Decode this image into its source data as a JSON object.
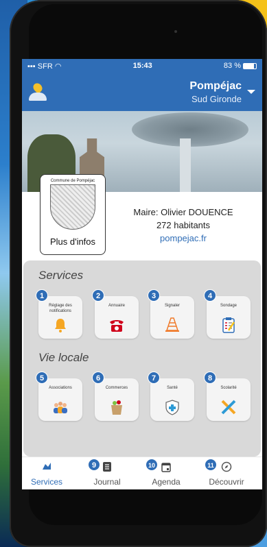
{
  "status_bar": {
    "carrier": "SFR",
    "time": "15:43",
    "battery": "83 %"
  },
  "header": {
    "town": "Pompéjac",
    "region": "Sud Gironde"
  },
  "info": {
    "crest_name": "Commune de Pompéjac",
    "more_label": "Plus d'infos",
    "mayor": "Maire: Olivier DOUENCE",
    "inhabitants": "272 habitants",
    "website": "pompejac.fr"
  },
  "sections": {
    "services": "Services",
    "local": "Vie locale"
  },
  "services": [
    {
      "num": "1",
      "label": "Réglage des notifications",
      "icon": "bell-icon"
    },
    {
      "num": "2",
      "label": "Annuaire",
      "icon": "phone-icon"
    },
    {
      "num": "3",
      "label": "Signaler",
      "icon": "traffic-cone-icon"
    },
    {
      "num": "4",
      "label": "Sondage",
      "icon": "survey-icon"
    }
  ],
  "local": [
    {
      "num": "5",
      "label": "Associations",
      "icon": "people-icon"
    },
    {
      "num": "6",
      "label": "Commerces",
      "icon": "grocery-bag-icon"
    },
    {
      "num": "7",
      "label": "Santé",
      "icon": "health-shield-icon"
    },
    {
      "num": "8",
      "label": "Scolarité",
      "icon": "pencil-ruler-icon"
    }
  ],
  "tabs": [
    {
      "num": "",
      "label": "Services",
      "icon": "services-icon",
      "active": true
    },
    {
      "num": "9",
      "label": "Journal",
      "icon": "journal-icon",
      "active": false
    },
    {
      "num": "10",
      "label": "Agenda",
      "icon": "calendar-icon",
      "active": false
    },
    {
      "num": "11",
      "label": "Découvrir",
      "icon": "compass-icon",
      "active": false
    }
  ],
  "colors": {
    "brand": "#2f6db6",
    "bell": "#f5a623",
    "phone": "#d0021b",
    "cone": "#f07a2a",
    "health": "#2e9bd6"
  }
}
